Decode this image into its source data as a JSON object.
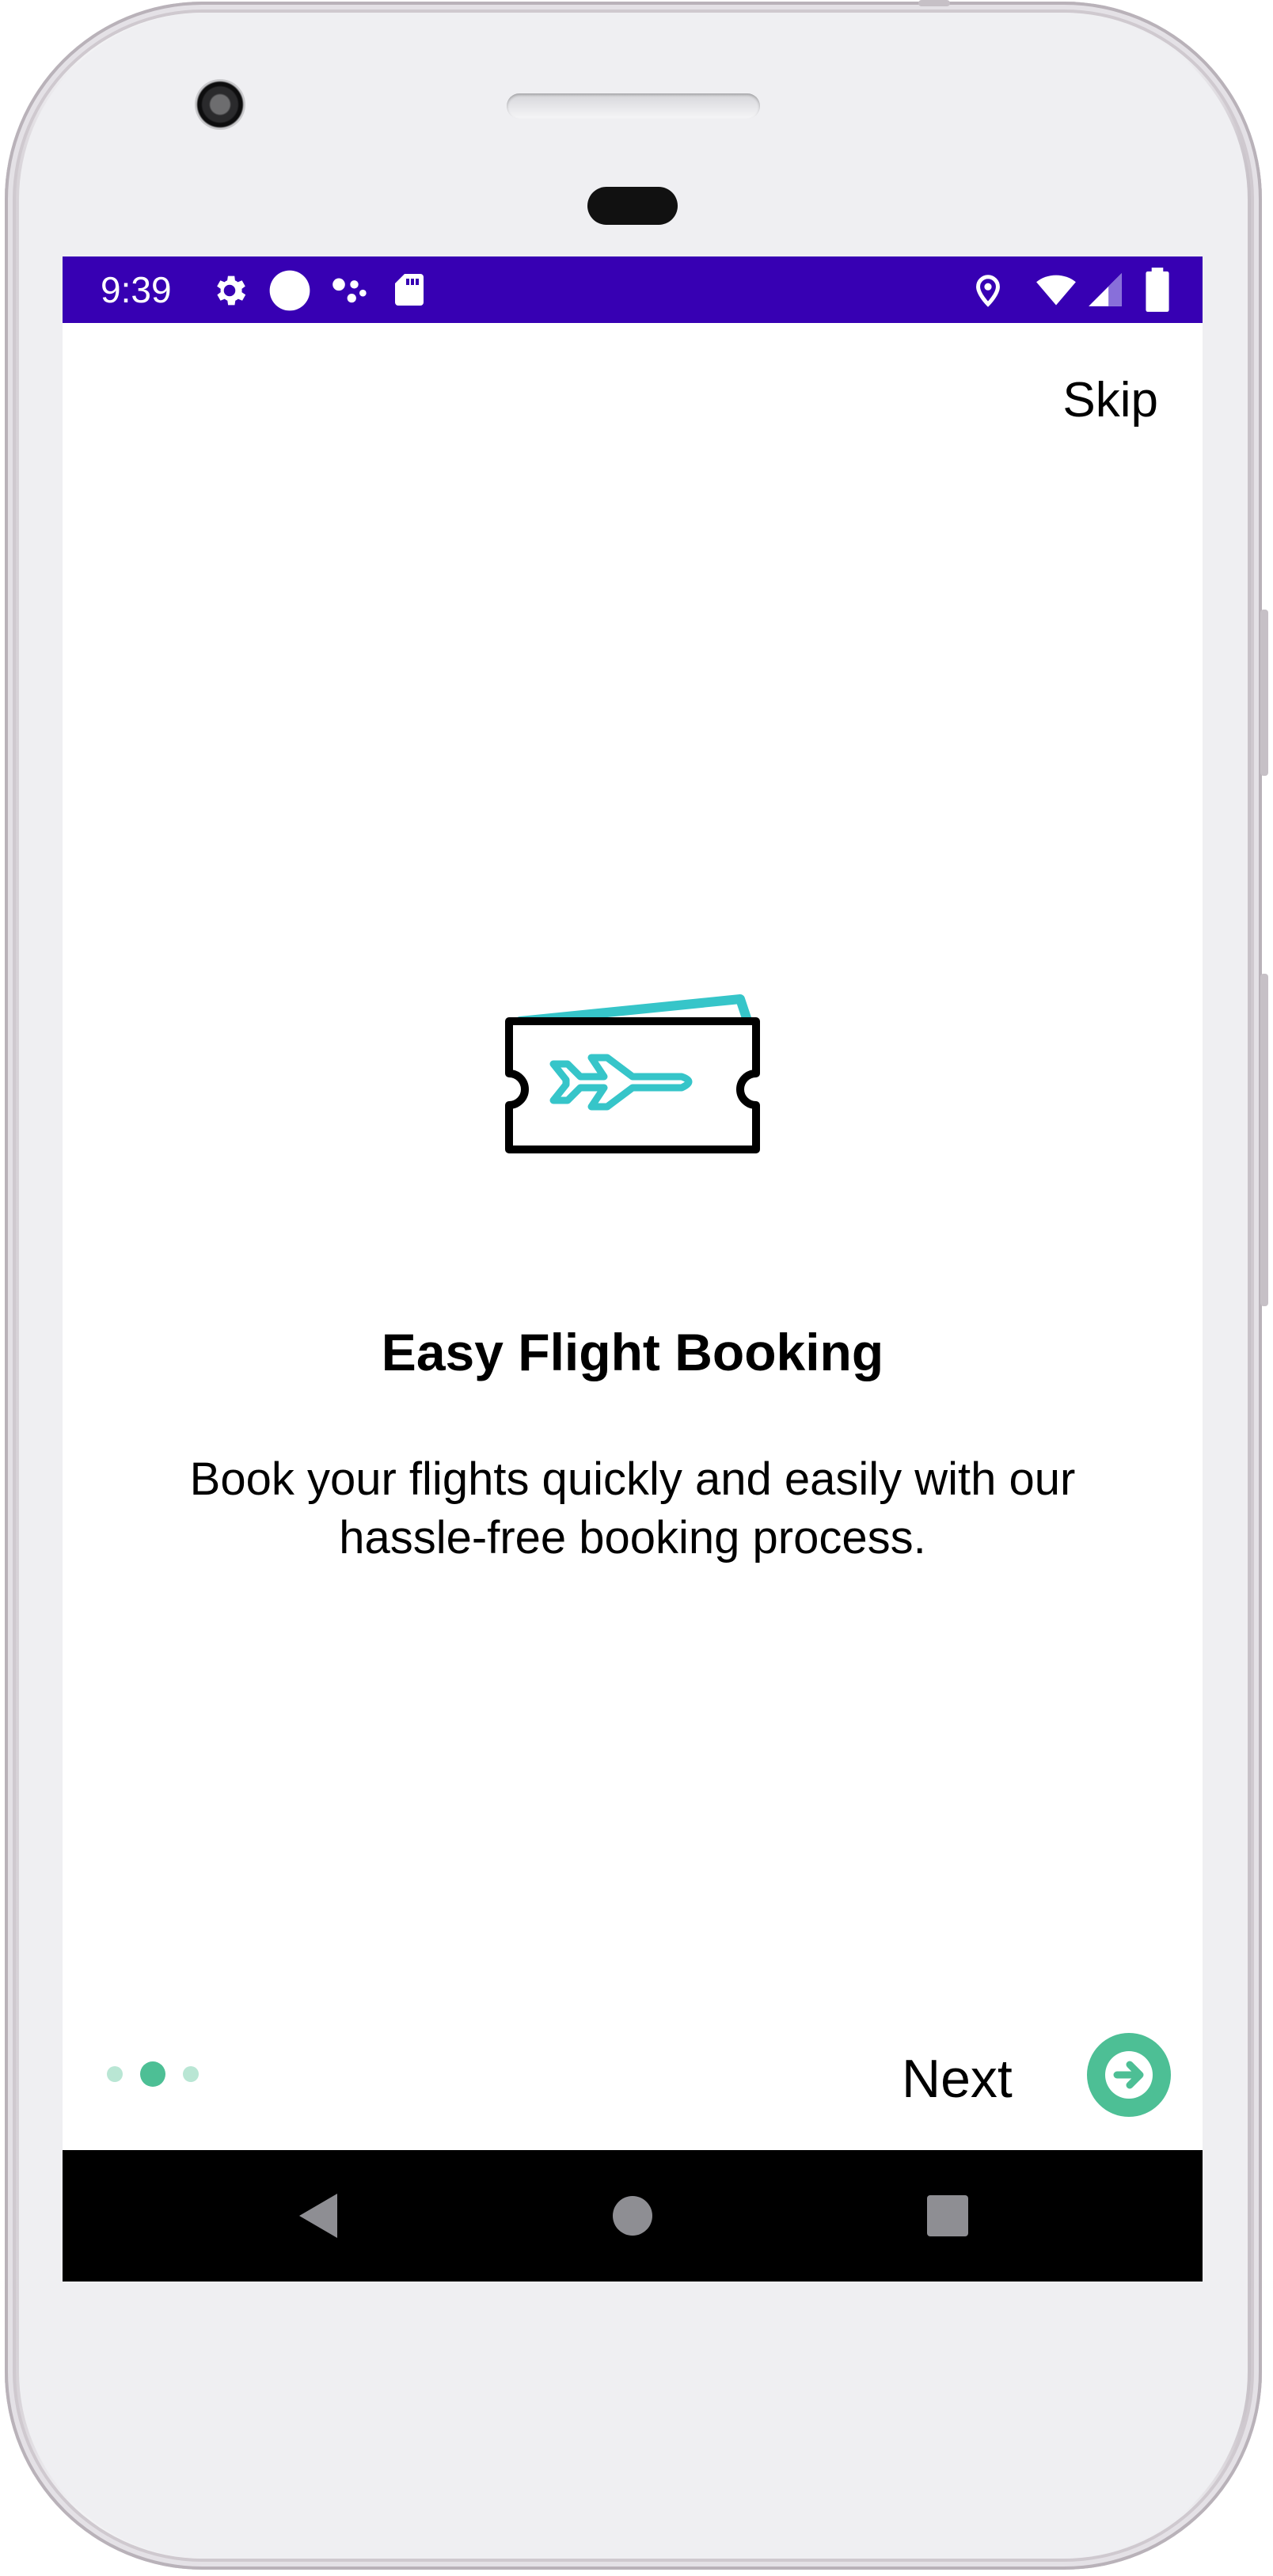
{
  "status_bar": {
    "time": "9:39",
    "background": "#3700b3",
    "icons": [
      "settings-gear-icon",
      "circle-icon",
      "assistant-dots-icon",
      "sd-card-icon",
      "location-pin-icon",
      "wifi-icon",
      "cellular-signal-icon",
      "battery-icon"
    ]
  },
  "onboarding": {
    "skip_label": "Skip",
    "illustration": "airplane-ticket-icon",
    "title": "Easy Flight Booking",
    "description": "Book your flights quickly and easily with our hassle-free booking process.",
    "page_indicator": {
      "total_pages": 3,
      "current_page": 2,
      "active_color": "#4dbf95",
      "inactive_color": "#b9e6d4"
    },
    "next_label": "Next",
    "accent_color": "#4dbf95",
    "illustration_accent": "#36c5c9"
  },
  "nav_bar": {
    "buttons": [
      "back-triangle-icon",
      "home-circle-icon",
      "recents-square-icon"
    ]
  }
}
